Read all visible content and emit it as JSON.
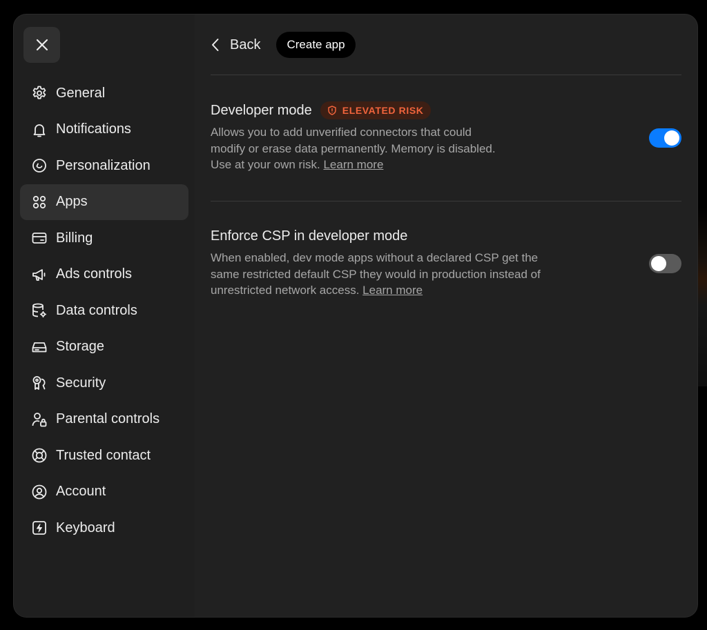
{
  "close": {
    "icon": "close-icon"
  },
  "sidebar": {
    "items": [
      {
        "label": "General",
        "icon": "gear-icon",
        "active": false
      },
      {
        "label": "Notifications",
        "icon": "bell-icon",
        "active": false
      },
      {
        "label": "Personalization",
        "icon": "personalization-icon",
        "active": false
      },
      {
        "label": "Apps",
        "icon": "apps-grid-icon",
        "active": true
      },
      {
        "label": "Billing",
        "icon": "credit-card-icon",
        "active": false
      },
      {
        "label": "Ads controls",
        "icon": "megaphone-icon",
        "active": false
      },
      {
        "label": "Data controls",
        "icon": "database-gear-icon",
        "active": false
      },
      {
        "label": "Storage",
        "icon": "storage-drive-icon",
        "active": false
      },
      {
        "label": "Security",
        "icon": "security-key-icon",
        "active": false
      },
      {
        "label": "Parental controls",
        "icon": "parental-lock-icon",
        "active": false
      },
      {
        "label": "Trusted contact",
        "icon": "lifebuoy-icon",
        "active": false
      },
      {
        "label": "Account",
        "icon": "account-icon",
        "active": false
      },
      {
        "label": "Keyboard",
        "icon": "keyboard-bolt-icon",
        "active": false
      }
    ]
  },
  "header": {
    "back_label": "Back",
    "create_app_label": "Create app"
  },
  "settings": {
    "developer_mode": {
      "title": "Developer mode",
      "badge": "ELEVATED RISK",
      "description": "Allows you to add unverified connectors that could modify or erase data permanently. Memory is disabled. Use at your own risk.",
      "learn_more": "Learn more",
      "enabled": true
    },
    "enforce_csp": {
      "title": "Enforce CSP in developer mode",
      "description": "When enabled, dev mode apps without a declared CSP get the same restricted default CSP they would in production instead of unrestricted network access.",
      "learn_more": "Learn more",
      "enabled": false
    }
  },
  "colors": {
    "accent": "#0a7cff",
    "risk": "#f0643c",
    "panel": "#212121"
  }
}
